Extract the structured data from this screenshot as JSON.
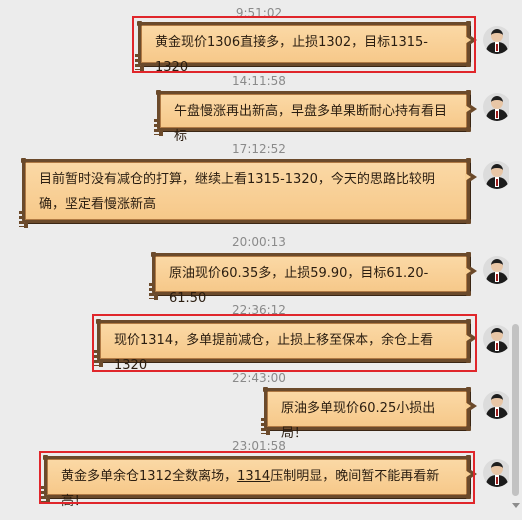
{
  "messages": [
    {
      "time": "9:51:02",
      "text": "黄金现价1306直接多，止损1302，目标1315-1320"
    },
    {
      "time": "14:11:58",
      "text": "午盘慢涨再出新高，早盘多单果断耐心持有看目标"
    },
    {
      "time": "17:12:52",
      "text_line1": "目前暂时没有减仓的打算，继续上看1315-1320，今天的思路比较明",
      "text_line2": "确，坚定看慢涨新高"
    },
    {
      "time": "20:00:13",
      "text": "原油现价60.35多，止损59.90，目标61.20-61.50"
    },
    {
      "time": "22:36:12",
      "text": "现价1314，多单提前减仓，止损上移至保本，余仓上看1320"
    },
    {
      "time": "22:43:00",
      "text": "原油多单现价60.25小损出局！"
    },
    {
      "time": "23:01:58",
      "text_pre": "黄金多单余仓1312全数离场，",
      "text_ul": "1314",
      "text_post": "压制明显，晚间暂不能再看新高！"
    }
  ],
  "colors": {
    "bubble_fill": "#f8cf94",
    "bubble_border": "#6b4a2b",
    "highlight": "#e0262b",
    "timestamp": "#8a8a8a"
  }
}
